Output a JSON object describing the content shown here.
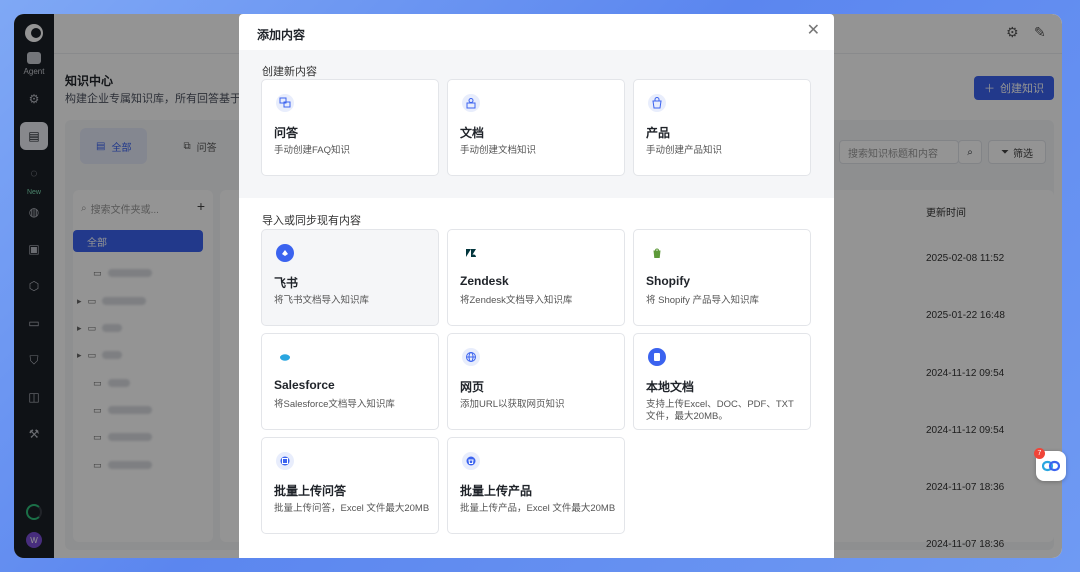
{
  "nav": {
    "agent_label": "Agent",
    "new_badge": "New",
    "avatar_letter": "W"
  },
  "page": {
    "title": "知识中心",
    "description": "构建企业专属知识库，所有回答基于知",
    "create_button": "创建知识"
  },
  "tabs": [
    {
      "label": "全部"
    },
    {
      "label": "问答"
    }
  ],
  "search": {
    "placeholder": "搜索知识标题和内容",
    "filter_label": "筛选"
  },
  "folders": {
    "search_placeholder": "搜索文件夹或...",
    "all_label": "全部"
  },
  "table": {
    "header_time": "更新时间",
    "times": [
      "2025-02-08 11:52",
      "2025-01-22 16:48",
      "2024-11-12 09:54",
      "2024-11-12 09:54",
      "2024-11-07 18:36",
      "2024-11-07 18:36"
    ]
  },
  "modal": {
    "title": "添加内容",
    "section_create": "创建新内容",
    "section_import": "导入或同步现有内容",
    "create_cards": [
      {
        "name": "问答",
        "desc": "手动创建FAQ知识",
        "icon": "qa-icon"
      },
      {
        "name": "文档",
        "desc": "手动创建文档知识",
        "icon": "document-icon"
      },
      {
        "name": "产品",
        "desc": "手动创建产品知识",
        "icon": "product-icon"
      }
    ],
    "import_cards": [
      {
        "name": "飞书",
        "desc": "将飞书文档导入知识库",
        "icon": "feishu-icon"
      },
      {
        "name": "Zendesk",
        "desc": "将Zendesk文档导入知识库",
        "icon": "zendesk-icon"
      },
      {
        "name": "Shopify",
        "desc": "将 Shopify 产品导入知识库",
        "icon": "shopify-icon"
      },
      {
        "name": "Salesforce",
        "desc": "将Salesforce文档导入知识库",
        "icon": "salesforce-icon"
      },
      {
        "name": "网页",
        "desc": "添加URL以获取网页知识",
        "icon": "globe-icon"
      },
      {
        "name": "本地文档",
        "desc": "支持上传Excel、DOC、PDF、TXT文件，最大20MB。",
        "icon": "local-file-icon"
      },
      {
        "name": "批量上传问答",
        "desc": "批量上传问答，Excel 文件最大20MB",
        "icon": "bulk-qa-icon"
      },
      {
        "name": "批量上传产品",
        "desc": "批量上传产品，Excel 文件最大20MB",
        "icon": "bulk-product-icon"
      }
    ]
  },
  "floating": {
    "badge_count": "7"
  },
  "colors": {
    "accent": "#3b63ef",
    "nav_bg": "#1b1f27",
    "zendesk": "#03363d",
    "shopify": "#5e9a3a",
    "salesforce": "#2aa6e0"
  }
}
